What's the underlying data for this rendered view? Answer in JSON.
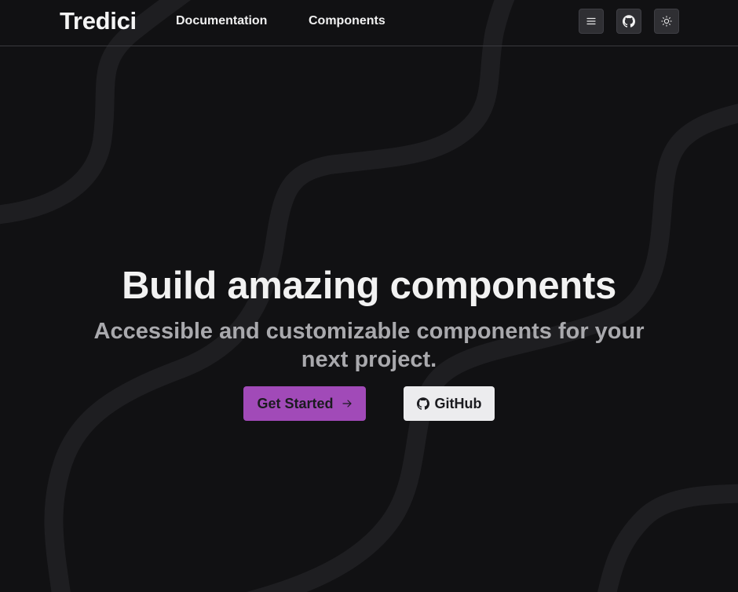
{
  "header": {
    "logo": "Tredici",
    "nav": [
      {
        "label": "Documentation"
      },
      {
        "label": "Components"
      }
    ],
    "icons": [
      "menu-icon",
      "github-icon",
      "sun-icon"
    ]
  },
  "hero": {
    "title": "Build amazing components",
    "subtitle": "Accessible and customizable components for your next project.",
    "primary_button": "Get Started",
    "primary_button_icon": "arrow-right-icon",
    "secondary_button": "GitHub",
    "secondary_button_icon": "github-icon"
  },
  "colors": {
    "background": "#111113",
    "primary": "#a14ab8",
    "secondary_button_bg": "#ececee",
    "subtitle": "#a9a9ad"
  }
}
